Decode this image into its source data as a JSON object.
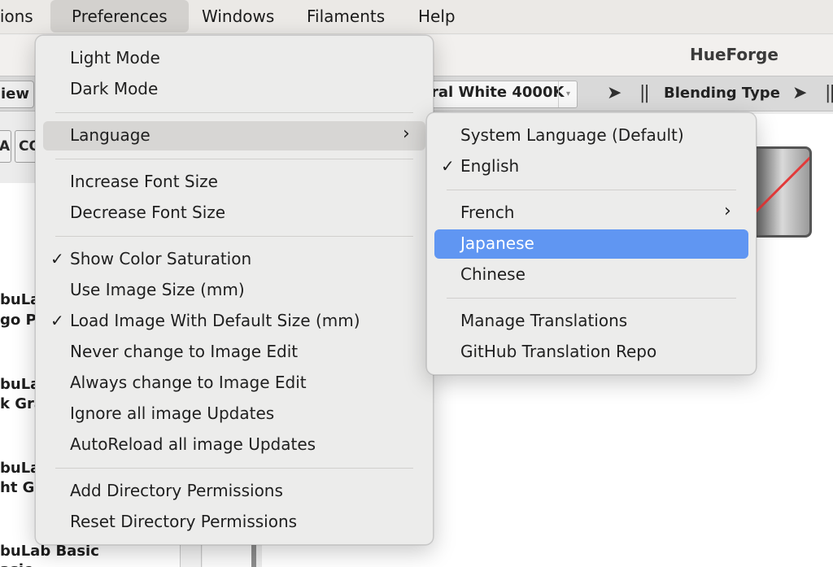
{
  "menubar": {
    "items": [
      "tions",
      "Preferences",
      "Windows",
      "Filaments",
      "Help"
    ]
  },
  "app": {
    "title": "HueForge",
    "view_tab": "iew",
    "light_select_value": "ral White 4000K",
    "blending_label": "Blending Type",
    "tabs": [
      "A",
      "CO"
    ],
    "filament_rows": [
      "buLa",
      "go Pu",
      "buLa",
      "k Gra",
      "buLa",
      "ht Gr",
      "buLab Basic",
      "asic"
    ]
  },
  "preferences_menu": {
    "items": [
      {
        "label": "Light Mode",
        "checked": false
      },
      {
        "label": "Dark Mode",
        "checked": false
      },
      {
        "label": "Language",
        "submenu": true,
        "highlighted": true
      },
      {
        "label": "Increase Font Size",
        "checked": false
      },
      {
        "label": "Decrease Font Size",
        "checked": false
      },
      {
        "label": "Show Color Saturation",
        "checked": true
      },
      {
        "label": "Use Image Size (mm)",
        "checked": false
      },
      {
        "label": "Load Image With Default Size (mm)",
        "checked": true
      },
      {
        "label": "Never change to Image Edit",
        "checked": false
      },
      {
        "label": "Always change to Image Edit",
        "checked": false
      },
      {
        "label": "Ignore all image Updates",
        "checked": false
      },
      {
        "label": "AutoReload all image Updates",
        "checked": false
      },
      {
        "label": "Add Directory Permissions",
        "checked": false
      },
      {
        "label": "Reset Directory Permissions",
        "checked": false
      }
    ]
  },
  "language_menu": {
    "items": [
      {
        "label": "System Language (Default)",
        "checked": false
      },
      {
        "label": "English",
        "checked": true
      },
      {
        "label": "French",
        "submenu": true
      },
      {
        "label": "Japanese",
        "highlighted": true
      },
      {
        "label": "Chinese"
      },
      {
        "label": "Manage Translations"
      },
      {
        "label": "GitHub Translation Repo"
      }
    ]
  },
  "glyphs": {
    "check": "✓",
    "chevron": "›",
    "arrow_right": "➤",
    "separator": "||",
    "dropdown": "▾"
  },
  "icons": {
    "check": "checkmark-icon",
    "submenu": "chevron-right-icon"
  },
  "colors": {
    "highlight_blue": "#6096f2",
    "highlight_gray": "#d7d6d4",
    "menu_bg": "#ececeb",
    "preview_line": "#e23a3a"
  }
}
